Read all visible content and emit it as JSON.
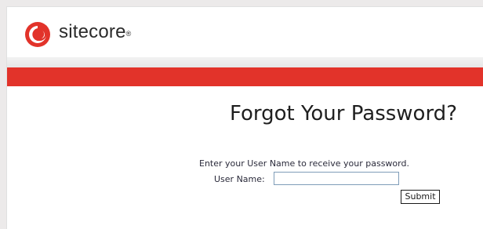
{
  "brand": {
    "name": "sitecore",
    "trademark": "®"
  },
  "colors": {
    "accent_red": "#e2332a",
    "logo_red": "#e2332a",
    "text": "#1f1f1f"
  },
  "icons": {
    "logo": "sitecore-swirl-logo-icon"
  },
  "page": {
    "heading": "Forgot Your Password?",
    "instructions": "Enter your User Name to receive your password.",
    "username_label": "User Name:",
    "username_value": "",
    "submit_label": "Submit"
  }
}
